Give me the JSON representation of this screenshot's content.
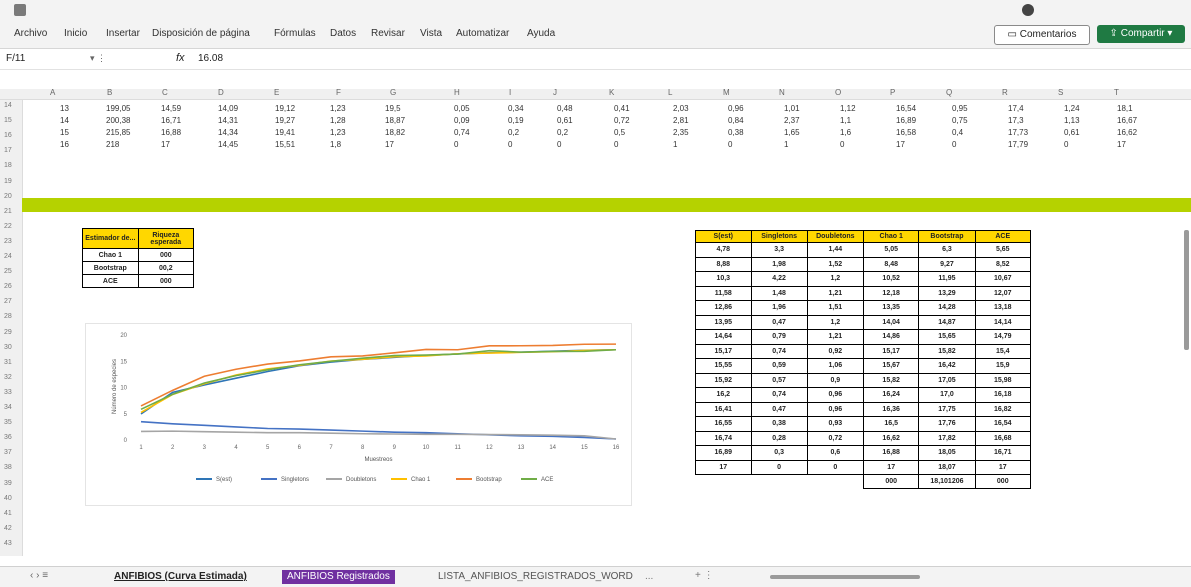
{
  "ribbon": {
    "tabs": [
      "Archivo",
      "Inicio",
      "Insertar",
      "Disposición de página",
      "Fórmulas",
      "Datos",
      "Revisar",
      "Vista",
      "Automatizar",
      "Ayuda"
    ],
    "comments_label": "Comentarios",
    "share_label": "Compartir"
  },
  "formula_bar": {
    "name_box": "F/11",
    "fx": "fx",
    "value": "16.08"
  },
  "columns": [
    "A",
    "B",
    "C",
    "D",
    "E",
    "F",
    "G",
    "H",
    "I",
    "J",
    "K",
    "L",
    "M",
    "N",
    "O",
    "P",
    "Q",
    "R",
    "S",
    "T"
  ],
  "rows": [
    "14",
    "15",
    "16",
    "17",
    "18",
    "19",
    "20",
    "21",
    "22",
    "23",
    "24",
    "25",
    "26",
    "27",
    "28",
    "29",
    "30",
    "31",
    "32",
    "33",
    "34",
    "35",
    "36",
    "37",
    "38",
    "39",
    "40",
    "41",
    "42",
    "43"
  ],
  "top_data": [
    [
      "13",
      "199,05",
      "14,59",
      "14,09",
      "19,12",
      "1,23",
      "19,5",
      "0,05",
      "0,34",
      "0,48",
      "0,41",
      "2,03",
      "0,96",
      "1,01",
      "1,12",
      "16,54",
      "0,95",
      "17,4",
      "1,24",
      "18,1"
    ],
    [
      "14",
      "200,38",
      "16,71",
      "14,31",
      "19,27",
      "1,28",
      "18,87",
      "0,09",
      "0,19",
      "0,61",
      "0,72",
      "2,81",
      "0,84",
      "2,37",
      "1,1",
      "16,89",
      "0,75",
      "17,3",
      "1,13",
      "16,67"
    ],
    [
      "15",
      "215,85",
      "16,88",
      "14,34",
      "19,41",
      "1,23",
      "18,82",
      "0,74",
      "0,2",
      "0,2",
      "0,5",
      "2,35",
      "0,38",
      "1,65",
      "1,6",
      "16,58",
      "0,4",
      "17,73",
      "0,61",
      "16,62"
    ],
    [
      "16",
      "218",
      "17",
      "14,45",
      "15,51",
      "1,8",
      "17",
      "0",
      "0",
      "0",
      "0",
      "1",
      "0",
      "1",
      "0",
      "17",
      "0",
      "17,79",
      "0",
      "17"
    ]
  ],
  "small_table": {
    "headers": [
      "Estimador de...",
      "Riqueza esperada"
    ],
    "rows": [
      [
        "Chao 1",
        "000"
      ],
      [
        "Bootstrap",
        "00,2"
      ],
      [
        "ACE",
        "000"
      ]
    ]
  },
  "right_table": {
    "headers": [
      "S(est)",
      "Singletons",
      "Doubletons",
      "Chao 1",
      "Bootstrap",
      "ACE"
    ],
    "rows": [
      [
        "4,78",
        "3,3",
        "1,44",
        "5,05",
        "6,3",
        "5,65"
      ],
      [
        "8,88",
        "1,98",
        "1,52",
        "8,48",
        "9,27",
        "8,52"
      ],
      [
        "10,3",
        "4,22",
        "1,2",
        "10,52",
        "11,95",
        "10,67"
      ],
      [
        "11,58",
        "1,48",
        "1,21",
        "12,18",
        "13,29",
        "12,07"
      ],
      [
        "12,86",
        "1,96",
        "1,51",
        "13,35",
        "14,28",
        "13,18"
      ],
      [
        "13,95",
        "0,47",
        "1,2",
        "14,04",
        "14,87",
        "14,14"
      ],
      [
        "14,64",
        "0,79",
        "1,21",
        "14,86",
        "15,65",
        "14,79"
      ],
      [
        "15,17",
        "0,74",
        "0,92",
        "15,17",
        "15,82",
        "15,4"
      ],
      [
        "15,55",
        "0,59",
        "1,06",
        "15,67",
        "16,42",
        "15,9"
      ],
      [
        "15,92",
        "0,57",
        "0,9",
        "15,82",
        "17,05",
        "15,98"
      ],
      [
        "16,2",
        "0,74",
        "0,96",
        "16,24",
        "17,0",
        "16,18"
      ],
      [
        "16,41",
        "0,47",
        "0,96",
        "16,36",
        "17,75",
        "16,82"
      ],
      [
        "16,55",
        "0,38",
        "0,93",
        "16,5",
        "17,76",
        "16,54"
      ],
      [
        "16,74",
        "0,28",
        "0,72",
        "16,62",
        "17,82",
        "16,68"
      ],
      [
        "16,89",
        "0,3",
        "0,6",
        "16,88",
        "18,05",
        "16,71"
      ],
      [
        "17",
        "0",
        "0",
        "17",
        "18,07",
        "17"
      ]
    ],
    "footer": [
      "000",
      "18,101206",
      "000"
    ]
  },
  "chart_data": {
    "type": "line",
    "x": [
      1,
      2,
      3,
      4,
      5,
      6,
      7,
      8,
      9,
      10,
      11,
      12,
      13,
      14,
      15,
      16
    ],
    "ylim": [
      0,
      20
    ],
    "yticks": [
      0,
      5,
      10,
      15,
      20
    ],
    "xlabel": "Muestreos",
    "ylabel": "Número de especies",
    "legend_position": "bottom",
    "series": [
      {
        "name": "S(est)",
        "color": "#2e75b6",
        "values": [
          4.78,
          8.88,
          10.3,
          11.58,
          12.86,
          13.95,
          14.64,
          15.17,
          15.55,
          15.92,
          16.2,
          16.41,
          16.55,
          16.74,
          16.89,
          17
        ]
      },
      {
        "name": "Singletons",
        "color": "#4472c4",
        "values": [
          3.3,
          2.9,
          2.6,
          2.3,
          2.0,
          1.9,
          1.7,
          1.5,
          1.3,
          1.2,
          1.0,
          0.8,
          0.6,
          0.5,
          0.3,
          0
        ]
      },
      {
        "name": "Doubletons",
        "color": "#a5a5a5",
        "values": [
          1.44,
          1.5,
          1.4,
          1.3,
          1.2,
          1.2,
          1.1,
          1.0,
          0.95,
          0.9,
          0.9,
          0.85,
          0.8,
          0.72,
          0.6,
          0
        ]
      },
      {
        "name": "Chao 1",
        "color": "#ffc000",
        "values": [
          5.05,
          8.48,
          10.52,
          12.18,
          13.35,
          14.04,
          14.86,
          15.17,
          15.67,
          15.82,
          16.24,
          16.36,
          16.5,
          16.62,
          16.88,
          17
        ]
      },
      {
        "name": "Bootstrap",
        "color": "#ed7d31",
        "values": [
          6.3,
          9.27,
          11.95,
          13.29,
          14.28,
          14.87,
          15.65,
          15.82,
          16.42,
          17.05,
          17.0,
          17.75,
          17.76,
          17.82,
          18.05,
          18.07
        ]
      },
      {
        "name": "ACE",
        "color": "#70ad47",
        "values": [
          5.65,
          8.52,
          10.67,
          12.07,
          13.18,
          14.14,
          14.79,
          15.4,
          15.9,
          15.98,
          16.18,
          16.82,
          16.54,
          16.68,
          16.71,
          17
        ]
      }
    ]
  },
  "sheets": {
    "active": "ANFIBIOS (Curva Estimada)",
    "purple": "ANFIBIOS Registrados",
    "other": "LISTA_ANFIBIOS_REGISTRADOS_WORD",
    "more": "..."
  }
}
